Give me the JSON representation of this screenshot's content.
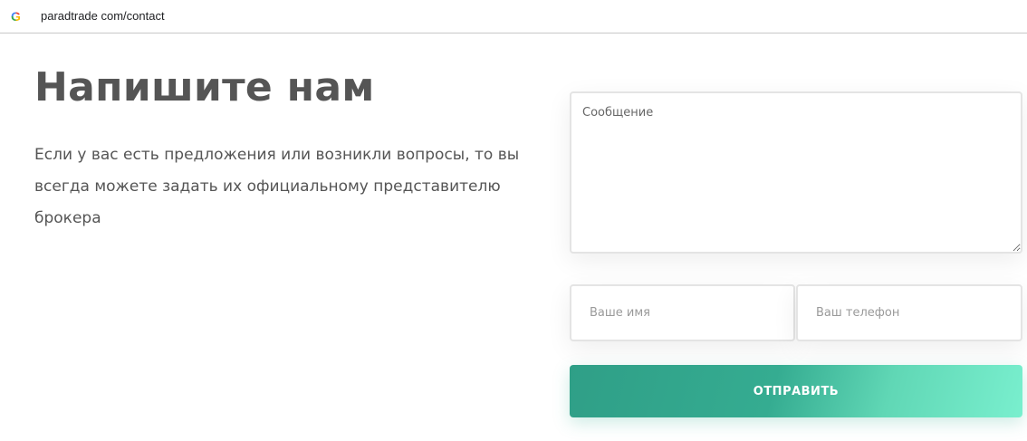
{
  "browser": {
    "favicon_letter": "G",
    "url": "paradtrade com/contact"
  },
  "contact": {
    "title": "Напишите нам",
    "intro": "Если у вас есть предложения или возникли вопросы, то вы всегда можете задать их официальному представителю брокера"
  },
  "form": {
    "message_placeholder": "Сообщение",
    "name_placeholder": "Ваше имя",
    "phone_placeholder": "Ваш телефон",
    "submit_label": "ОТПРАВИТЬ"
  },
  "colors": {
    "heading": "#555555",
    "button_start": "#2f9f87",
    "button_end": "#79efce"
  }
}
